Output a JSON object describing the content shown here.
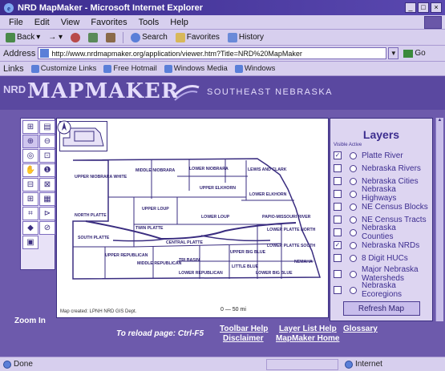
{
  "window": {
    "title": "NRD MapMaker - Microsoft Internet Explorer",
    "controls": [
      "_",
      "□",
      "×"
    ]
  },
  "menubar": [
    "File",
    "Edit",
    "View",
    "Favorites",
    "Tools",
    "Help"
  ],
  "toolbar": {
    "back": "Back",
    "search": "Search",
    "favorites": "Favorites",
    "history": "History"
  },
  "address": {
    "label": "Address",
    "url": "http://www.nrdmapmaker.org/application/viewer.htm?Title=NRD%20MapMaker",
    "go": "Go"
  },
  "links": {
    "label": "Links",
    "items": [
      "Customize Links",
      "Free Hotmail",
      "Windows Media",
      "Windows"
    ]
  },
  "banner": {
    "prefix": "NRD",
    "title": "MAPMAKER",
    "region": "SOUTHEAST NEBRASKA"
  },
  "tools": [
    "⊞",
    "▤",
    "⊕",
    "⊖",
    "◎",
    "⊡",
    "✋",
    "❶",
    "⊟",
    "⊠",
    "⊞",
    "▦",
    "⌗",
    "⊳",
    "◆",
    "⊘",
    "▣"
  ],
  "map": {
    "regions": [
      "UPPER NIOBRARA WHITE",
      "MIDDLE NIOBRARA",
      "LOWER NIOBRARA",
      "LEWIS AND CLARK",
      "UPPER ELKHORN",
      "LOWER ELKHORN",
      "NORTH PLATTE",
      "UPPER LOUP",
      "LOWER LOUP",
      "PAPIO-MISSOURI RIVER",
      "SOUTH PLATTE",
      "TWIN PLATTE",
      "CENTRAL PLATTE",
      "LOWER PLATTE NORTH",
      "LOWER PLATTE SOUTH",
      "UPPER BIG BLUE",
      "UPPER REPUBLICAN",
      "MIDDLE REPUBLICAN",
      "TRI BASIN",
      "LITTLE BLUE",
      "LOWER REPUBLICAN",
      "LOWER BIG BLUE",
      "NEMAHA"
    ],
    "credit": "Map created: LPNH NRD GIS Dept.",
    "scale": "0 — 50 mi"
  },
  "layers": {
    "heading": "Layers",
    "visible_active_label": "Visible Active",
    "items": [
      {
        "name": "Platte River",
        "visible": true
      },
      {
        "name": "Nebraska Rivers",
        "visible": false
      },
      {
        "name": "Nebraska Cities",
        "visible": false
      },
      {
        "name": "Nebraska Highways",
        "visible": false
      },
      {
        "name": "NE Census Blocks",
        "visible": false
      },
      {
        "name": "NE Census Tracts",
        "visible": false
      },
      {
        "name": "Nebraska Counties",
        "visible": false
      },
      {
        "name": "Nebraska NRDs",
        "visible": true
      },
      {
        "name": "8 Digit HUCs",
        "visible": false
      },
      {
        "name": "Major Nebraska Watersheds",
        "visible": false
      },
      {
        "name": "Nebraska Ecoregions",
        "visible": false
      }
    ],
    "refresh_label": "Refresh Map"
  },
  "footer": {
    "zoom_label": "Zoom In",
    "reload_hint": "To reload page: Ctrl-F5",
    "links": [
      "Toolbar Help",
      "Layer List Help",
      "Glossary",
      "Disclaimer",
      "MapMaker Home"
    ]
  },
  "status": {
    "state": "Done",
    "zone": "Internet"
  }
}
